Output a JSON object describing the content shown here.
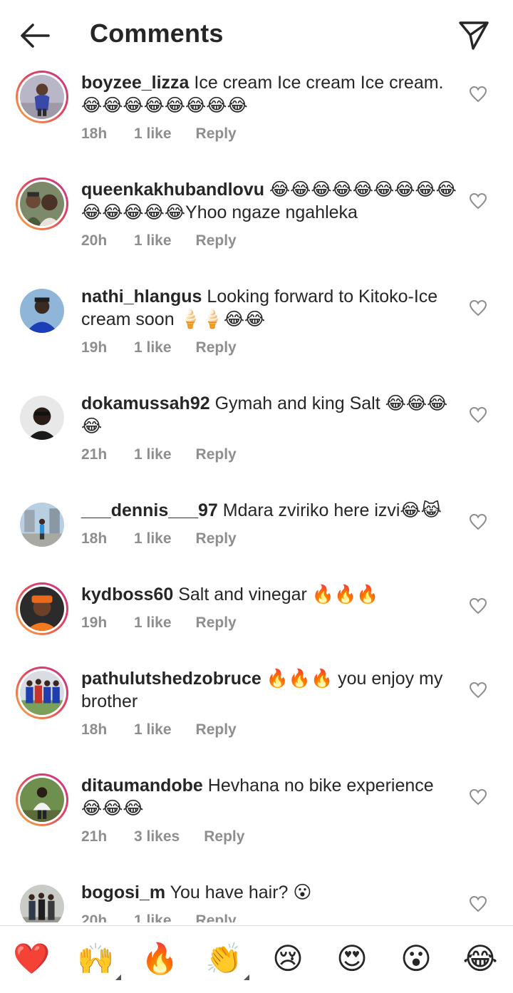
{
  "header": {
    "title": "Comments",
    "back_icon": "arrow-left-icon",
    "share_icon": "paper-plane-icon"
  },
  "comments": [
    {
      "username": "boyzee_lizza",
      "text": "Ice cream Ice cream Ice cream. 😂😂😂😂😂😂😂😂",
      "time": "18h",
      "likes": "1 like",
      "reply": "Reply",
      "story_ring": true
    },
    {
      "username": "queenkakhubandlovu",
      "text": "😂😂😂😂😂😂😂😂😂😂😂😂😂😂Yhoo ngaze ngahleka",
      "time": "20h",
      "likes": "1 like",
      "reply": "Reply",
      "story_ring": true
    },
    {
      "username": "nathi_hlangus",
      "text": "Looking forward to Kitoko-Ice cream soon 🍦🍦😂😂",
      "time": "19h",
      "likes": "1 like",
      "reply": "Reply",
      "story_ring": false
    },
    {
      "username": "dokamussah92",
      "text": "Gymah and king Salt 😂😂😂😂",
      "time": "21h",
      "likes": "1 like",
      "reply": "Reply",
      "story_ring": false
    },
    {
      "username": "___dennis___97",
      "text": "Mdara zviriko here izvi😂😹",
      "time": "18h",
      "likes": "1 like",
      "reply": "Reply",
      "story_ring": false
    },
    {
      "username": "kydboss60",
      "text": "Salt and vinegar 🔥🔥🔥",
      "time": "19h",
      "likes": "1 like",
      "reply": "Reply",
      "story_ring": true
    },
    {
      "username": "pathulutshedzobruce",
      "text": "🔥🔥🔥 you enjoy my brother",
      "time": "18h",
      "likes": "1 like",
      "reply": "Reply",
      "story_ring": true
    },
    {
      "username": "ditaumandobe",
      "text": "Hevhana no bike experience 😂😂😂",
      "time": "21h",
      "likes": "3 likes",
      "reply": "Reply",
      "story_ring": true
    },
    {
      "username": "bogosi_m",
      "text": "You have hair? 😮",
      "time": "20h",
      "likes": "1 like",
      "reply": "Reply",
      "story_ring": false
    }
  ],
  "quick_reactions": [
    "❤️",
    "🙌",
    "🔥",
    "👏",
    "😢",
    "😍",
    "😮",
    "😂"
  ],
  "colors": {
    "text": "#262626",
    "meta": "#8e8e8e",
    "divider": "#dbdbdb"
  }
}
